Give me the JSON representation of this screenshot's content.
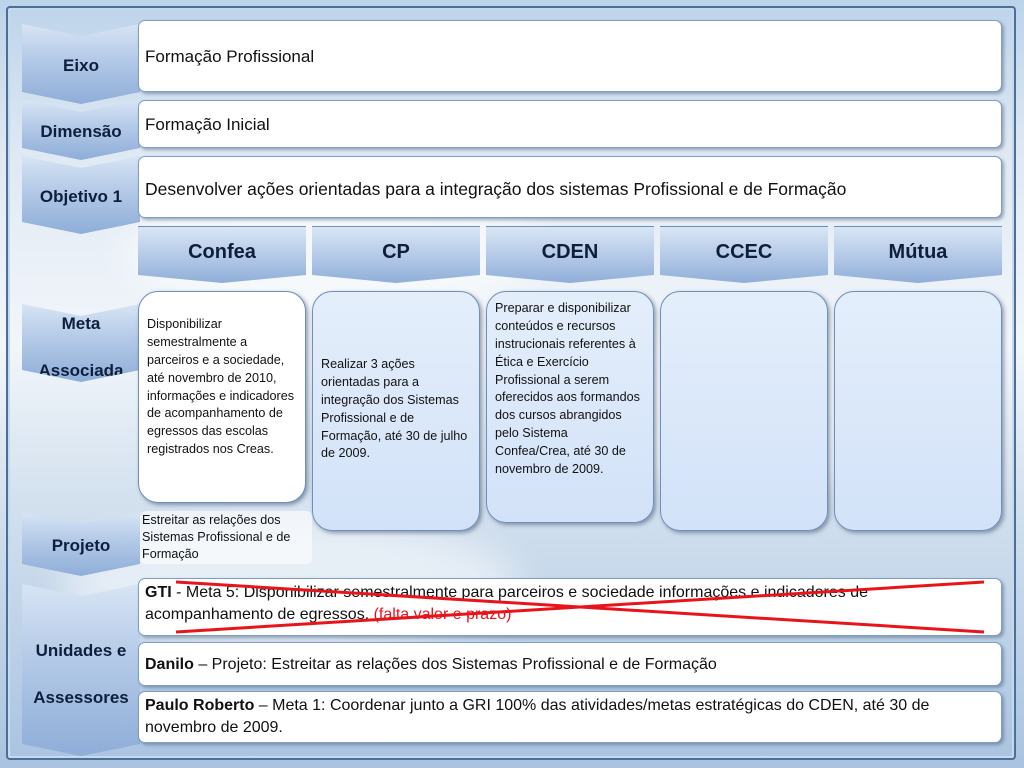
{
  "labels": {
    "eixo": "Eixo",
    "dimensao": "Dimensão",
    "objetivo": "Objetivo 1",
    "meta_l1": "Meta",
    "meta_l2": "Associada",
    "projeto": "Projeto",
    "unidades_l1": "Unidades e",
    "unidades_l2": "Assessores"
  },
  "eixo_value": "Formação Profissional",
  "dimensao_value": "Formação Inicial",
  "objetivo_value": "Desenvolver ações orientadas para a integração dos sistemas Profissional e de Formação",
  "entities": [
    "Confea",
    "CP",
    "CDEN",
    "CCEC",
    "Mútua"
  ],
  "metas": {
    "confea": "Disponibilizar semestralmente a parceiros e a sociedade, até novembro de 2010, informações e indicadores de acompanhamento de egressos das escolas registrados nos Creas.",
    "cp": "Realizar 3 ações orientadas para a integração dos Sistemas Profissional e de Formação, até 30 de julho de 2009.",
    "cden": "Preparar e disponibilizar conteúdos e recursos instrucionais referentes à Ética e Exercício Profissional a serem oferecidos aos formandos dos cursos abrangidos pelo Sistema Confea/Crea, até 30 de novembro de 2009.",
    "ccec": "",
    "mutua": ""
  },
  "projeto_value": "Estreitar as relações dos Sistemas Profissional e de Formação",
  "unidades": [
    {
      "name": "GTI",
      "text": " - Meta 5:  Disponibilizar semestralmente para parceiros e sociedade informações e indicadores de acompanhamento de egressos.",
      "note": " (falta valor e prazo)"
    },
    {
      "name": "Danilo",
      "text": " – Projeto: Estreitar as relações dos Sistemas Profissional e de Formação"
    },
    {
      "name": "Paulo Roberto",
      "text": " – Meta 1: Coordenar junto a GRI 100% das atividades/metas estratégicas do CDEN, até 30 de novembro de 2009."
    }
  ],
  "colors": {
    "strike": "#e8141b",
    "label_text": "#0d1f3c",
    "chevron": "#b3c9e7"
  }
}
